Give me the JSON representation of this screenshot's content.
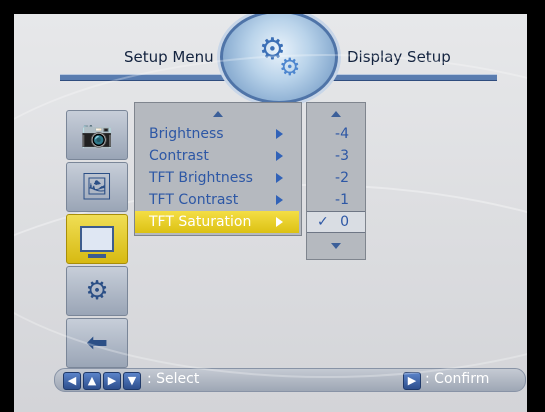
{
  "header": {
    "left_title": "Setup Menu",
    "right_title": "Display Setup",
    "logo_icon": "gear-icon"
  },
  "sidebar": {
    "items": [
      {
        "name": "camera-settings",
        "icon": "camera-wrench-icon"
      },
      {
        "name": "image-settings",
        "icon": "picture-icon"
      },
      {
        "name": "display-setup",
        "icon": "monitor-icon",
        "active": true
      },
      {
        "name": "system-settings",
        "icon": "picture-gear-icon"
      },
      {
        "name": "exit",
        "icon": "exit-arrow-icon"
      }
    ]
  },
  "menu": {
    "items": [
      {
        "label": "Brightness"
      },
      {
        "label": "Contrast"
      },
      {
        "label": "TFT Brightness"
      },
      {
        "label": "TFT Contrast"
      },
      {
        "label": "TFT Saturation",
        "selected": true
      }
    ]
  },
  "values": {
    "items": [
      "-4",
      "-3",
      "-2",
      "-1",
      "0"
    ],
    "selected": "0",
    "check": "✓"
  },
  "footer": {
    "select_text": ": Select",
    "confirm_text": ": Confirm"
  },
  "colors": {
    "highlight": "#e9cf2a",
    "text_blue": "#2d57a5",
    "bar_blue": "#5a7db0"
  }
}
